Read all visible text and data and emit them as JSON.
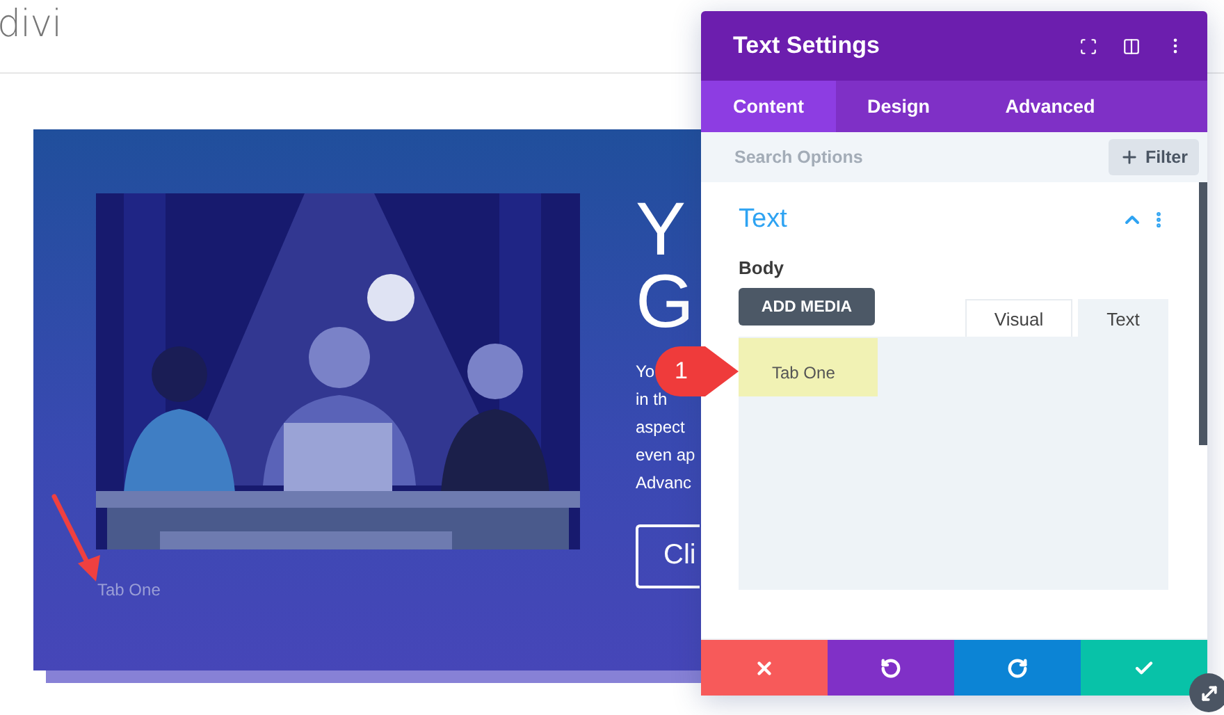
{
  "site": {
    "logo": "divi"
  },
  "hero": {
    "heading_lines": [
      "Y",
      "G"
    ],
    "body_lines": [
      "Yo",
      "in th",
      "aspect",
      "even ap",
      "Advanc"
    ],
    "button": "Cli",
    "caption": "Tab One"
  },
  "panel": {
    "title": "Text Settings",
    "tabs": [
      {
        "label": "Content",
        "selected": true
      },
      {
        "label": "Design",
        "selected": false
      },
      {
        "label": "Advanced",
        "selected": false
      }
    ],
    "search": {
      "placeholder": "Search Options"
    },
    "filter_button": "Filter",
    "section": {
      "title": "Text",
      "expanded": true
    },
    "field": {
      "label": "Body",
      "add_media": "ADD MEDIA",
      "editor_tabs": [
        {
          "label": "Visual",
          "selected": false
        },
        {
          "label": "Text",
          "selected": true
        }
      ],
      "value": "Tab One",
      "highlighted": true
    },
    "marker": "1",
    "actions": [
      {
        "kind": "discard"
      },
      {
        "kind": "undo"
      },
      {
        "kind": "redo"
      },
      {
        "kind": "save"
      }
    ]
  }
}
